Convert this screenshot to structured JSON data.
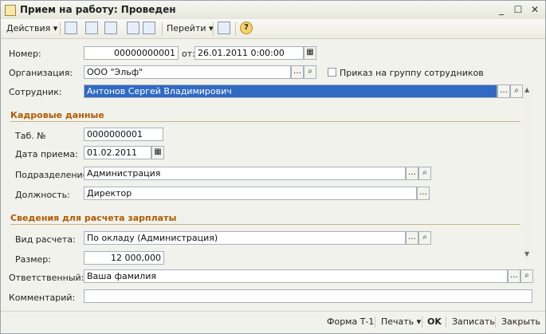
{
  "window": {
    "title": "Прием на работу: Проведен"
  },
  "toolbar": {
    "actions_label": "Действия",
    "goto_label": "Перейти"
  },
  "form": {
    "number_label": "Номер:",
    "number_value": "00000000001",
    "date_label": "от:",
    "date_value": "26.01.2011  0:00:00",
    "org_label": "Организация:",
    "org_value": "ООО \"Эльф\"",
    "group_order_label": "Приказ на группу сотрудников",
    "employee_label": "Сотрудник:",
    "employee_value": "Антонов Сергей Владимирович"
  },
  "hr": {
    "section_title": "Кадровые данные",
    "tab_label": "Таб. №",
    "tab_value": "0000000001",
    "hire_date_label": "Дата приема:",
    "hire_date_value": "01.02.2011",
    "dept_label": "Подразделение:",
    "dept_value": "Администрация",
    "position_label": "Должность:",
    "position_value": "Директор"
  },
  "salary": {
    "section_title": "Сведения для расчета зарплаты",
    "calc_type_label": "Вид расчета:",
    "calc_type_value": "По окладу (Администрация)",
    "amount_label": "Размер:",
    "amount_value": "12 000,000"
  },
  "footer_fields": {
    "responsible_label": "Ответственный:",
    "responsible_value": "Ваша фамилия",
    "comment_label": "Комментарий:",
    "comment_value": ""
  },
  "bottom": {
    "form_t1": "Форма Т-1",
    "print": "Печать",
    "ok": "OK",
    "save": "Записать",
    "close": "Закрыть"
  }
}
